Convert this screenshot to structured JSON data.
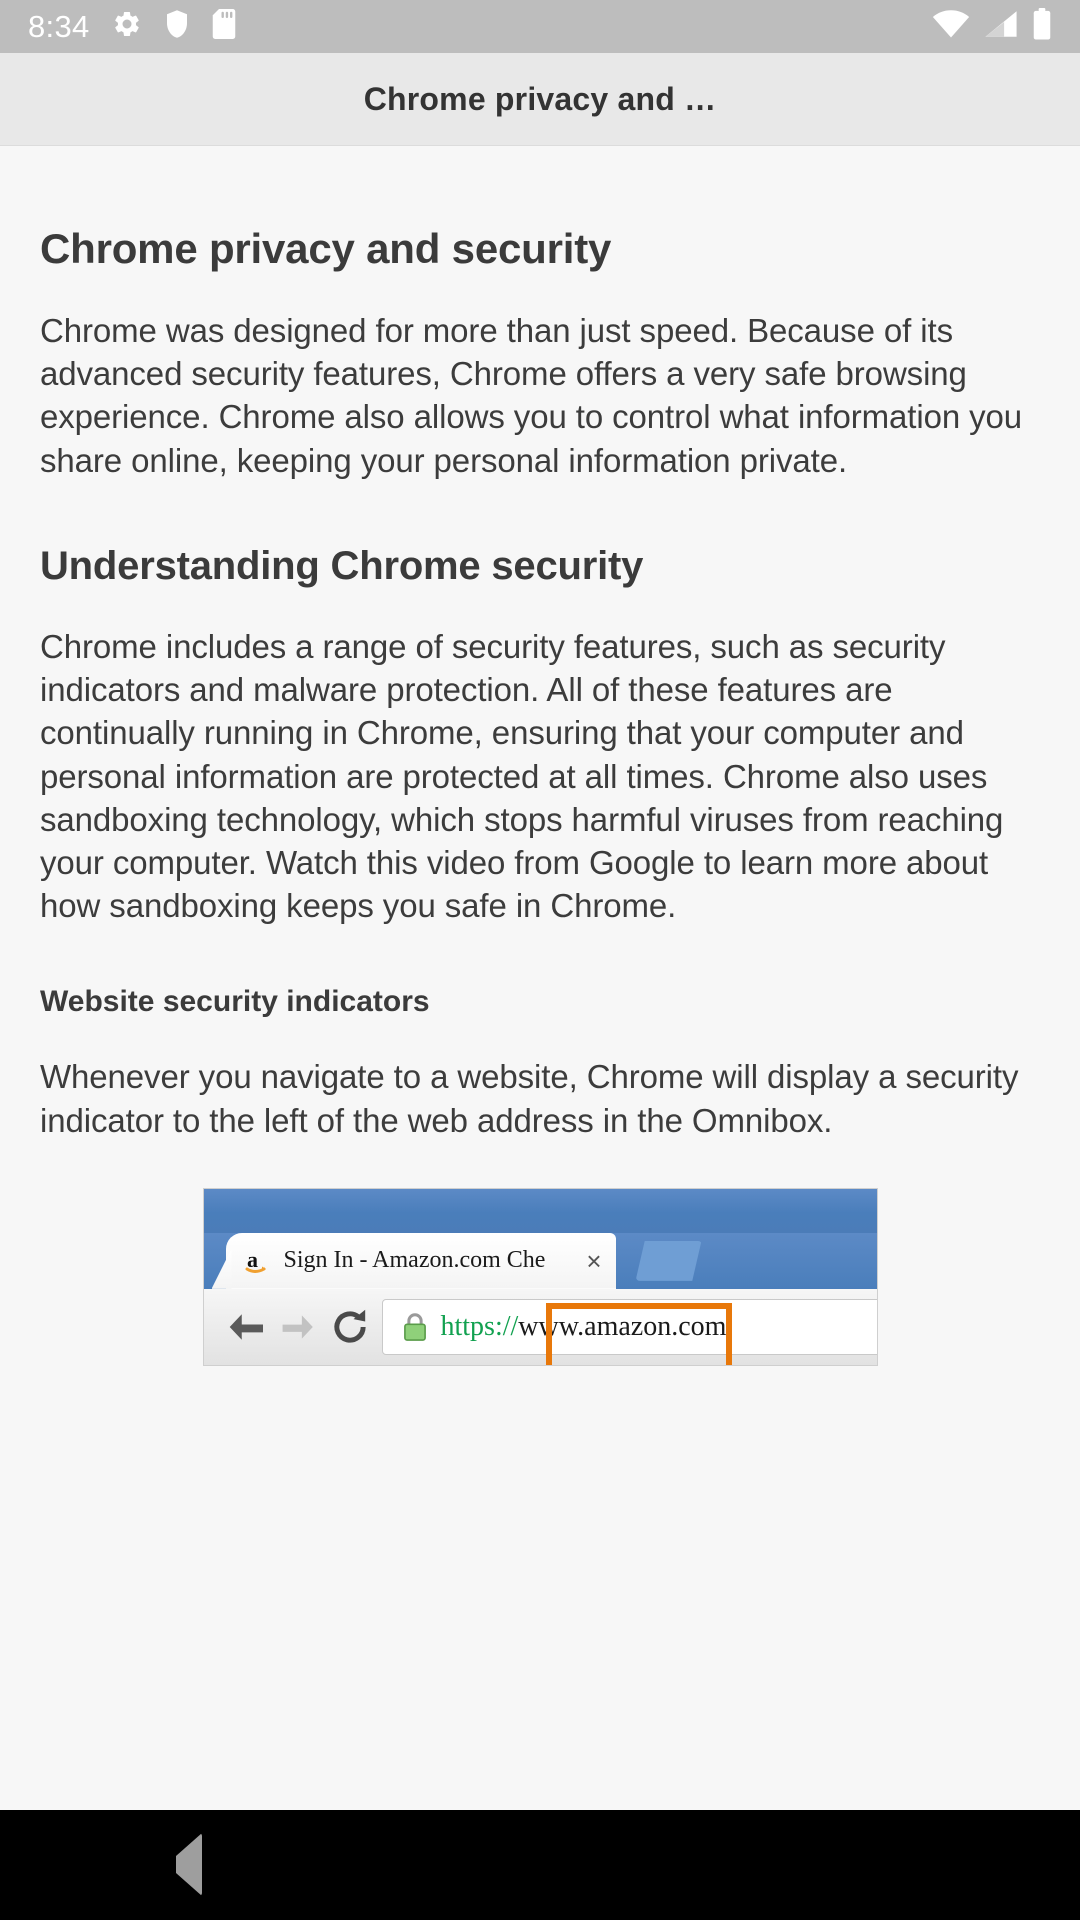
{
  "status_bar": {
    "time": "8:34",
    "left_icons": [
      "gear-icon",
      "shield-icon",
      "sd-card-icon"
    ],
    "right_icons": [
      "wifi-icon",
      "cell-signal-icon",
      "battery-icon"
    ],
    "background_color": "#bdbdbd",
    "icon_color": "#ffffff"
  },
  "app_bar": {
    "title": "Chrome privacy and …",
    "background_color": "#e8e8e8"
  },
  "article": {
    "h1": "Chrome privacy and security",
    "intro_paragraph": "Chrome was designed for more than just speed. Because of its advanced security features, Chrome offers a very safe browsing experience. Chrome also allows you to control what information you share online, keeping your personal information private.",
    "h2": "Understanding Chrome security",
    "security_paragraph": "Chrome includes a range of security features, such as security indicators and malware protection. All of these features are continually running in Chrome, ensuring that your computer and personal information are protected at all times. Chrome also uses sandboxing technology, which stops harmful viruses from reaching your computer. Watch this video from Google to learn more about how sandboxing keeps you safe in Chrome.",
    "h3": "Website security indicators",
    "indicators_paragraph": "Whenever you navigate to a website, Chrome will display a security indicator to the left of the web address in the Omnibox."
  },
  "browser_figure": {
    "tab_title": "Sign In - Amazon.com Che",
    "tab_close_label": "×",
    "favicon_name": "amazon-favicon",
    "back_icon": "back-arrow-icon",
    "forward_icon": "forward-arrow-icon",
    "reload_icon": "reload-icon",
    "lock_icon": "green-padlock-icon",
    "url_secure_part": "https://",
    "url_rest_part": "www.amazon.com",
    "titlebar_color": "#4a7ebb",
    "highlight_color": "#e8780a",
    "secure_text_color": "#12a150"
  },
  "nav_bar": {
    "back_label": "back-button",
    "home_label": "home-button",
    "recents_label": "recents-button",
    "background_color": "#000000",
    "icon_color": "#9e9e9e"
  }
}
